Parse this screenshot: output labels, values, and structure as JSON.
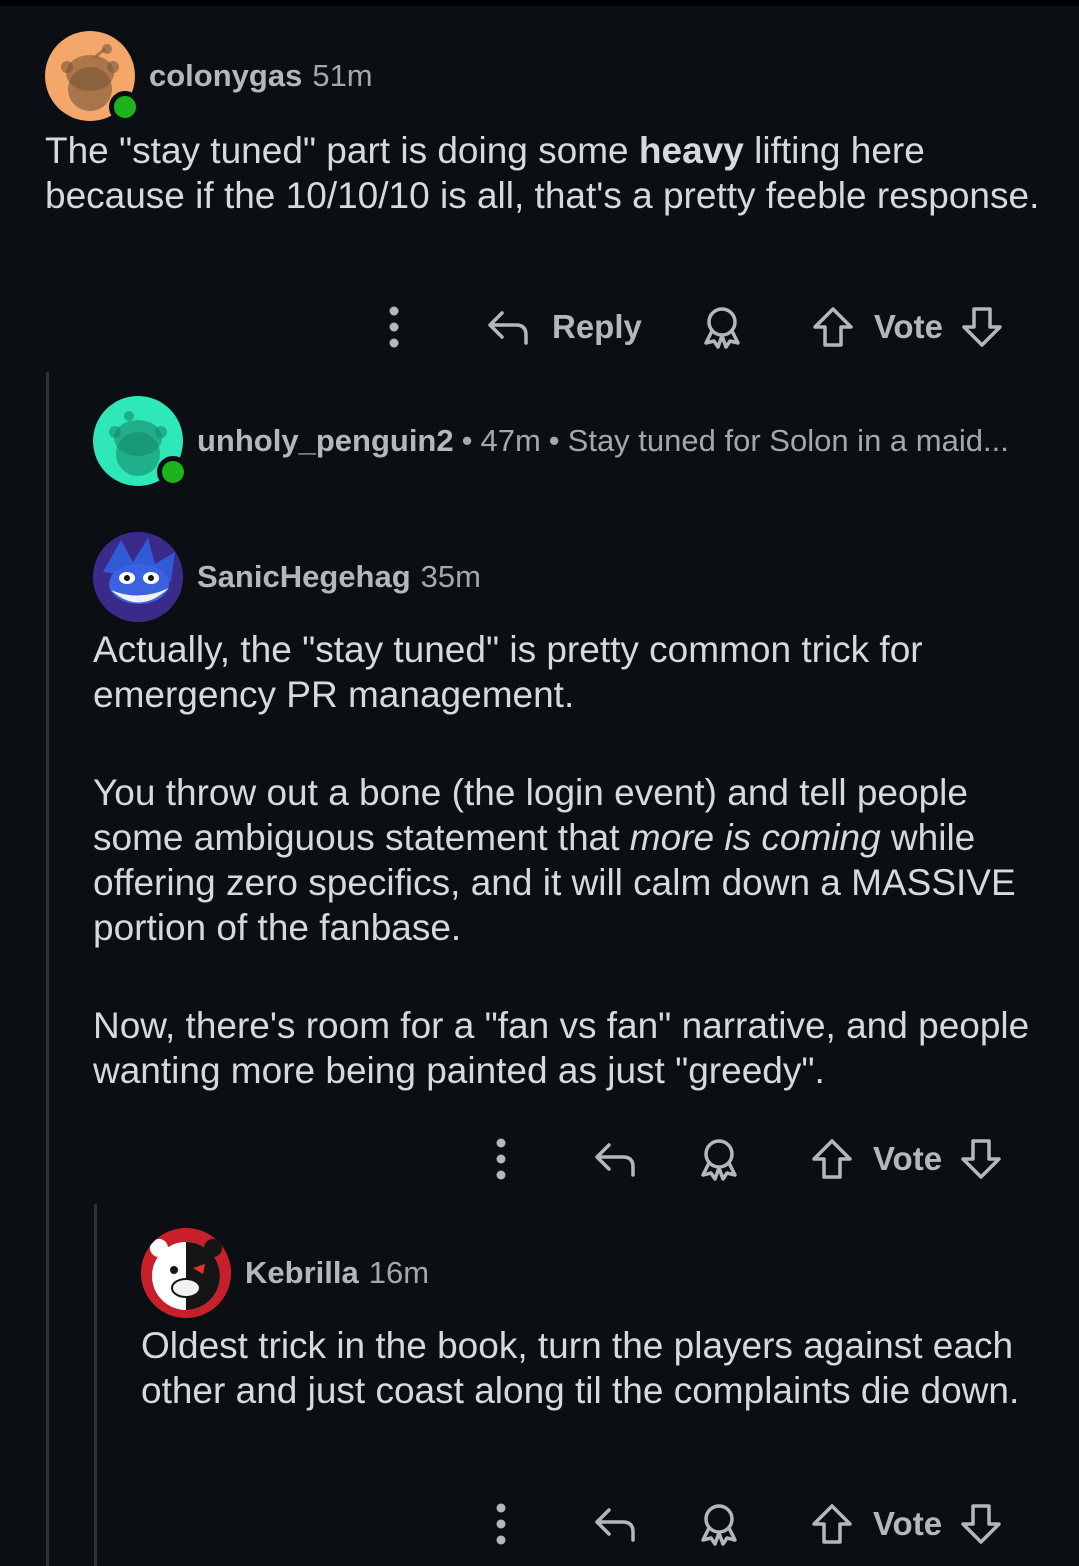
{
  "comments": [
    {
      "author": "colonygas",
      "time": "51m",
      "body_before": "The \"stay tuned\" part is doing some ",
      "body_bold": "heavy",
      "body_after": " lifting here because if the 10/10/10 is all, that's a pretty feeble response.",
      "reply_label": "Reply",
      "vote_label": "Vote"
    },
    {
      "author": "unholy_penguin2",
      "time": "47m",
      "separator": "•",
      "preview": "Stay tuned for Solon in a maid..."
    },
    {
      "author": "SanicHegehag",
      "time": "35m",
      "p1": "Actually, the \"stay tuned\" is pretty common trick for emergency PR management.",
      "p2_before": "You throw out a bone (the login event) and tell people some ambiguous statement that ",
      "p2_italic": "more is coming",
      "p2_after": " while offering zero specifics, and it will calm down a MASSIVE portion of the fanbase.",
      "p3": "Now, there's room for a \"fan vs fan\" narrative, and people wanting more being painted as just \"greedy\".",
      "vote_label": "Vote"
    },
    {
      "author": "Kebrilla",
      "time": "16m",
      "body": "Oldest trick in the book, turn the players against each other and just coast along til the complaints die down.",
      "vote_label": "Vote"
    }
  ],
  "icons": {
    "more": "more-vertical-icon",
    "reply": "reply-arrow-icon",
    "award": "award-icon",
    "upvote": "upvote-arrow-icon",
    "downvote": "downvote-arrow-icon"
  },
  "colors": {
    "background": "#0b0f13",
    "text": "#d7dadc",
    "meta": "#a4a8ab",
    "online": "#1db31d",
    "avatar_colonygas": "#f4a76a",
    "avatar_unholy_penguin2": "#2ee8b8"
  }
}
